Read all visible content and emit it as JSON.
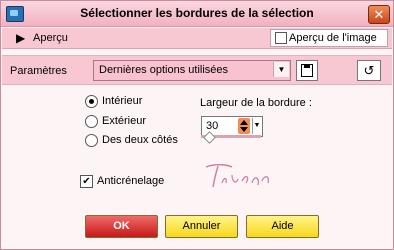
{
  "window": {
    "title": "Sélectionner les bordures de la sélection"
  },
  "preview": {
    "toggle_glyph": "▶",
    "label": "Aperçu",
    "image_preview_label": "Aperçu de l'image",
    "image_preview_checked": false
  },
  "parameters": {
    "label": "Paramètres",
    "preset_value": "Dernières options utilisées"
  },
  "border_side": {
    "options": [
      "Intérieur",
      "Extérieur",
      "Des deux côtés"
    ],
    "selected": "Intérieur"
  },
  "border_width": {
    "label": "Largeur de la bordure :",
    "value": "30"
  },
  "signature_text": "Titounc",
  "antialias": {
    "label": "Anticrénelage",
    "checked": true,
    "mark": "✔"
  },
  "buttons": {
    "ok": "OK",
    "cancel": "Annuler",
    "help": "Aide"
  },
  "icons": {
    "close": "close-icon",
    "save": "save-icon",
    "reset": "reset-icon",
    "app": "app-icon"
  },
  "colors": {
    "accent": "#f7c8d2",
    "ok": "#d92020",
    "secondary_button": "#f7e24a"
  }
}
